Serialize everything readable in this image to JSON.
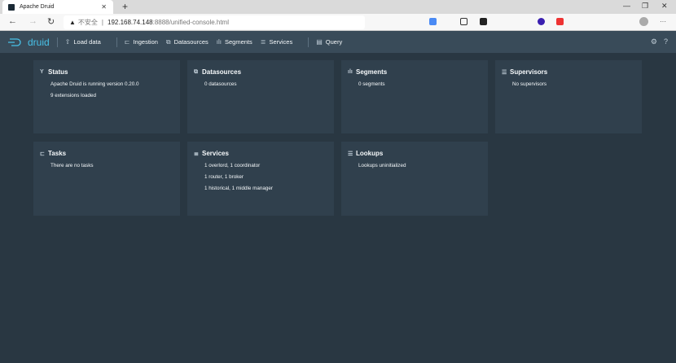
{
  "browser": {
    "tab_title": "Apache Druid",
    "insecure_label": "不安全",
    "url_host": "192.168.74.148",
    "url_rest": ":8888/unified-console.html"
  },
  "navbar": {
    "logo": "druid",
    "items": [
      "Load data",
      "Ingestion",
      "Datasources",
      "Segments",
      "Services",
      "Query"
    ]
  },
  "cards": [
    {
      "title": "Status",
      "icon": "status-icon",
      "lines": [
        "Apache Druid is running version 0.20.0",
        "9 extensions loaded"
      ]
    },
    {
      "title": "Datasources",
      "icon": "datasources-icon",
      "lines": [
        "0 datasources"
      ]
    },
    {
      "title": "Segments",
      "icon": "segments-icon",
      "lines": [
        "0 segments"
      ]
    },
    {
      "title": "Supervisors",
      "icon": "supervisors-icon",
      "lines": [
        "No supervisors"
      ]
    },
    {
      "title": "Tasks",
      "icon": "tasks-icon",
      "lines": [
        "There are no tasks"
      ]
    },
    {
      "title": "Services",
      "icon": "services-icon",
      "lines": [
        "1 overlord, 1 coordinator",
        "1 router, 1 broker",
        "1 historical, 1 middle manager"
      ]
    },
    {
      "title": "Lookups",
      "icon": "lookups-icon",
      "lines": [
        "Lookups uninitialized"
      ]
    }
  ]
}
